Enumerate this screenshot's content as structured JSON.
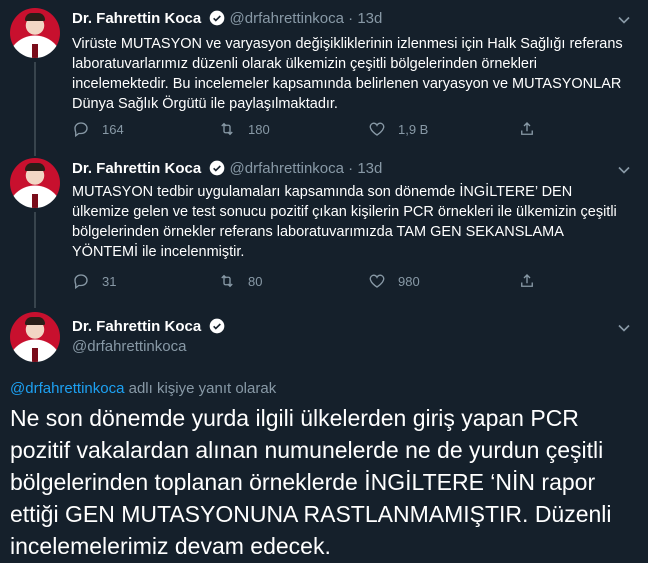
{
  "tweets": [
    {
      "name": "Dr. Fahrettin Koca",
      "handle": "@drfahrettinkoca",
      "dot": "·",
      "time": "13d",
      "text": "Virüste MUTASYON ve varyasyon değişikliklerinin izlenmesi için Halk Sağlığı referans laboratuvarlarımız düzenli olarak ülkemizin çeşitli bölgelerinden örnekleri incelemektedir. Bu incelemeler kapsamında belirlenen varyasyon ve MUTASYONLAR Dünya Sağlık Örgütü ile paylaşılmaktadır.",
      "replies": "164",
      "retweets": "180",
      "likes": "1,9 B"
    },
    {
      "name": "Dr. Fahrettin Koca",
      "handle": "@drfahrettinkoca",
      "dot": "·",
      "time": "13d",
      "text": "MUTASYON tedbir uygulamaları kapsamında son dönemde İNGİLTERE’ DEN ülkemize gelen ve test sonucu pozitif çıkan kişilerin PCR örnekleri ile ülkemizin çeşitli bölgelerinden örnekler referans laboratuvarımızda TAM GEN SEKANSLAMA YÖNTEMİ ile incelenmiştir.",
      "replies": "31",
      "retweets": "80",
      "likes": "980"
    }
  ],
  "main_tweet": {
    "name": "Dr. Fahrettin Koca",
    "handle": "@drfahrettinkoca",
    "reply_mention": "@drfahrettinkoca",
    "reply_suffix": " adlı kişiye yanıt olarak",
    "text": "Ne son dönemde yurda ilgili ülkelerden giriş yapan PCR pozitif vakalardan alınan numunelerde ne de yurdun çeşitli bölgelerinden toplanan örneklerde İNGİLTERE ‘NİN rapor ettiği GEN MUTASYONUNA  RASTLANMAMIŞTIR. Düzenli incelemelerimiz devam edecek."
  },
  "colors": {
    "background": "#15202b",
    "muted": "#8899a6",
    "accent": "#1da1f2",
    "line": "#38444d"
  },
  "icons": [
    "verified-badge-icon",
    "chevron-down-icon",
    "reply-icon",
    "retweet-icon",
    "like-icon",
    "share-icon"
  ]
}
